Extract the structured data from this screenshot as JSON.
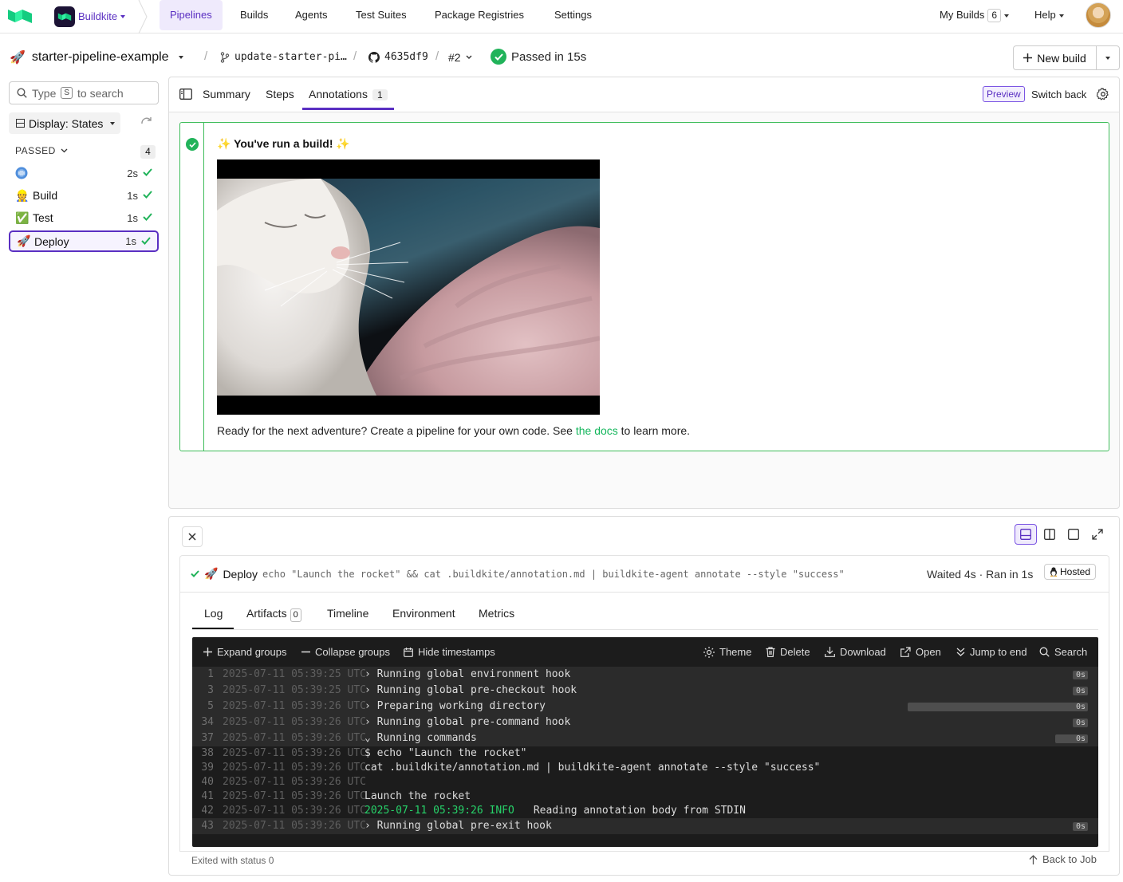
{
  "nav": {
    "org_name": "Buildkite",
    "items": [
      "Pipelines",
      "Builds",
      "Agents",
      "Test Suites",
      "Package Registries",
      "Settings"
    ],
    "my_builds_label": "My Builds",
    "my_builds_count": "6",
    "help_label": "Help"
  },
  "header": {
    "pipeline_emoji": "🚀",
    "pipeline_name": "starter-pipeline-example",
    "branch": "update-starter-pi…",
    "commit": "4635df9",
    "build_number": "#2",
    "status_text": "Passed in 15s",
    "new_build_label": "New build"
  },
  "sidebar": {
    "search_prefix": "Type",
    "search_key": "S",
    "search_suffix": "to search",
    "display_label": "Display: States",
    "group_label": "PASSED",
    "group_count": "4",
    "steps": [
      {
        "emoji": "",
        "label": "",
        "duration": "2s"
      },
      {
        "emoji": "👷",
        "label": "Build",
        "duration": "1s"
      },
      {
        "emoji": "✅",
        "label": "Test",
        "duration": "1s"
      },
      {
        "emoji": "🚀",
        "label": "Deploy",
        "duration": "1s"
      }
    ]
  },
  "tabs": {
    "summary": "Summary",
    "steps": "Steps",
    "annotations": "Annotations",
    "annotations_count": "1",
    "preview_badge": "Preview",
    "switch_back": "Switch back"
  },
  "annotation": {
    "title": "✨ You've run a build! ✨",
    "text_before": "Ready for the next adventure? Create a pipeline for your own code. See ",
    "link_text": "the docs",
    "text_after": " to learn more."
  },
  "job": {
    "emoji": "🚀",
    "name": "Deploy",
    "command": "echo \"Launch the rocket\" && cat .buildkite/annotation.md | buildkite-agent annotate --style \"success\"",
    "meta": "Waited 4s · Ran in 1s",
    "hosted_label": "Hosted",
    "subtabs": {
      "log": "Log",
      "artifacts": "Artifacts",
      "artifacts_count": "0",
      "timeline": "Timeline",
      "environment": "Environment",
      "metrics": "Metrics"
    },
    "log_toolbar": {
      "expand": "Expand groups",
      "collapse": "Collapse groups",
      "hide_ts": "Hide timestamps",
      "theme": "Theme",
      "delete": "Delete",
      "download": "Download",
      "open": "Open",
      "jump": "Jump to end",
      "search": "Search"
    },
    "log_lines": [
      {
        "n": "1",
        "ts": "2025-07-11 05:39:25 UTC",
        "text": "› Running global environment hook",
        "dur": "0s",
        "group": true,
        "bar": 0
      },
      {
        "n": "3",
        "ts": "2025-07-11 05:39:25 UTC",
        "text": "› Running global pre-checkout hook",
        "dur": "0s",
        "group": true,
        "bar": 0
      },
      {
        "n": "5",
        "ts": "2025-07-11 05:39:26 UTC",
        "text": "› Preparing working directory",
        "dur": "0s",
        "group": true,
        "bar": 0.55
      },
      {
        "n": "34",
        "ts": "2025-07-11 05:39:26 UTC",
        "text": "› Running global pre-command hook",
        "dur": "0s",
        "group": true,
        "bar": 0
      },
      {
        "n": "37",
        "ts": "2025-07-11 05:39:26 UTC",
        "text": "⌄ Running commands",
        "dur": "0s",
        "group": true,
        "bar": 0.1
      },
      {
        "n": "38",
        "ts": "2025-07-11 05:39:26 UTC",
        "text": "$ echo \"Launch the rocket\"",
        "dur": "",
        "group": false,
        "bar": 0
      },
      {
        "n": "39",
        "ts": "2025-07-11 05:39:26 UTC",
        "text": "cat .buildkite/annotation.md | buildkite-agent annotate --style \"success\"",
        "dur": "",
        "group": false,
        "bar": 0
      },
      {
        "n": "40",
        "ts": "2025-07-11 05:39:26 UTC",
        "text": "",
        "dur": "",
        "group": false,
        "bar": 0
      },
      {
        "n": "41",
        "ts": "2025-07-11 05:39:26 UTC",
        "text": "Launch the rocket",
        "dur": "",
        "group": false,
        "bar": 0
      },
      {
        "n": "42",
        "ts": "2025-07-11 05:39:26 UTC",
        "text": "",
        "info_ts": "2025-07-11 05:39:26 INFO",
        "info_msg": "Reading annotation body from STDIN",
        "dur": "",
        "group": false,
        "bar": 0
      },
      {
        "n": "43",
        "ts": "2025-07-11 05:39:26 UTC",
        "text": "› Running global pre-exit hook",
        "dur": "0s",
        "group": true,
        "bar": 0
      }
    ],
    "exit_text": "Exited with status 0",
    "back_to_job": "Back to Job"
  },
  "colors": {
    "accent": "#5a2fc2",
    "success": "#21b35a",
    "log_bg": "#1c1c1c"
  }
}
